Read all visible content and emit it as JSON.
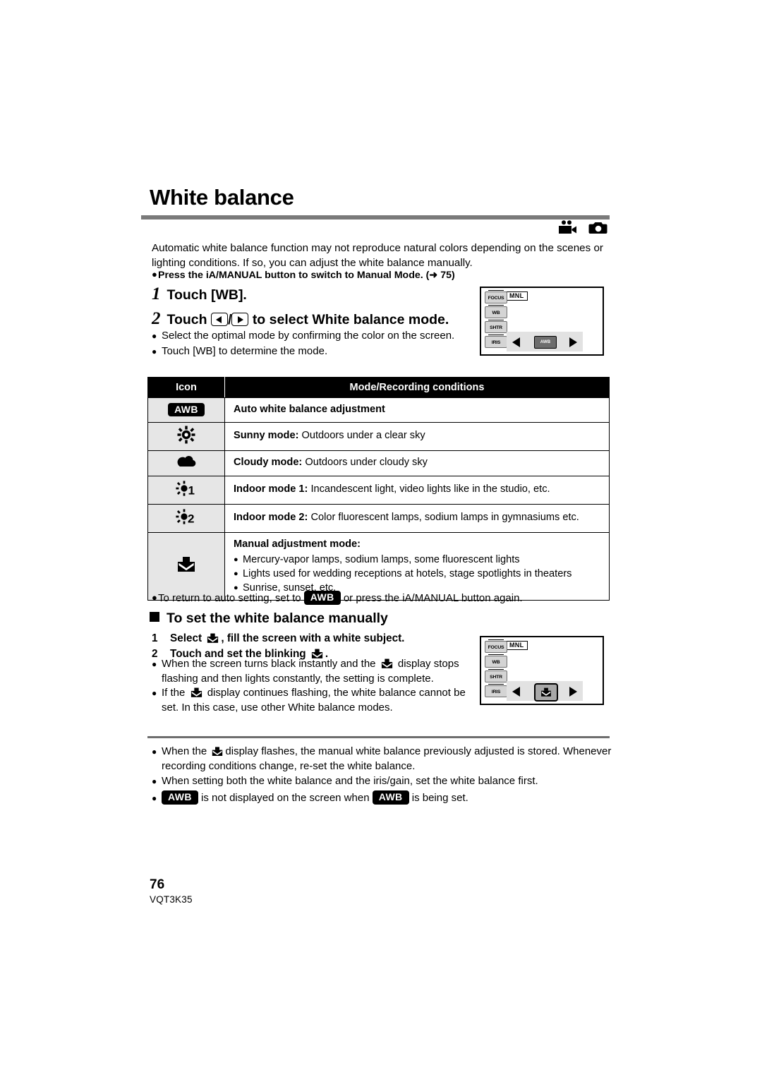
{
  "page": {
    "title": "White balance",
    "number": "76",
    "code": "VQT3K35"
  },
  "mode_icons": [
    "video-camera-icon",
    "photo-camera-icon"
  ],
  "intro": {
    "paragraph": "Automatic white balance function may not reproduce natural colors depending on the scenes or lighting conditions. If so, you can adjust the white balance manually.",
    "bullet": "Press the iA/MANUAL button to switch to Manual Mode. (➜ 75)"
  },
  "steps": {
    "step1_num": "1",
    "step1_text": "Touch [WB].",
    "step2_num": "2",
    "step2_prefix": "Touch",
    "step2_suffix": "to select White balance mode.",
    "notes": [
      "Select the optimal mode by confirming the color on the screen.",
      "Touch [WB] to determine the mode."
    ]
  },
  "lcd": {
    "mnl_label": "MNL",
    "side_buttons": [
      "FOCUS",
      "WB",
      "SHTR",
      "IRIS"
    ],
    "awb_chip": "AWB"
  },
  "table": {
    "headers": [
      "Icon",
      "Mode/Recording conditions"
    ],
    "rows": [
      {
        "icon": "awb-chip-icon",
        "icon_text": "AWB",
        "title": "Auto white balance adjustment",
        "detail": ""
      },
      {
        "icon": "sunny-icon",
        "icon_text": "",
        "title": "Sunny mode:",
        "detail": " Outdoors under a clear sky"
      },
      {
        "icon": "cloudy-icon",
        "icon_text": "",
        "title": "Cloudy mode:",
        "detail": " Outdoors under cloudy sky"
      },
      {
        "icon": "indoor-1-icon",
        "icon_text": "",
        "title": "Indoor mode 1:",
        "detail": " Incandescent light, video lights like in the studio, etc."
      },
      {
        "icon": "indoor-2-icon",
        "icon_text": "",
        "title": "Indoor mode 2:",
        "detail": " Color fluorescent lamps, sodium lamps in gymnasiums etc."
      },
      {
        "icon": "manual-wb-icon",
        "icon_text": "",
        "title": "Manual adjustment mode:",
        "detail": "",
        "sublist": [
          "Mercury-vapor lamps, sodium lamps, some fluorescent lights",
          "Lights used for wedding receptions at hotels, stage spotlights in theaters",
          "Sunrise, sunset, etc."
        ]
      }
    ]
  },
  "return_note": {
    "prefix": "To return to auto setting, set to",
    "chip": "AWB",
    "suffix": "or press the iA/MANUAL button again."
  },
  "manual_section": {
    "heading": "To set the white balance manually",
    "step1_num": "1",
    "step1_prefix": "Select",
    "step1_suffix": ", fill the screen with a white subject.",
    "step2_num": "2",
    "step2_prefix": "Touch and set the blinking",
    "step2_suffix": ".",
    "note1_a": "When the screen turns black instantly and the",
    "note1_b": "display stops flashing and then lights constantly, the setting is complete.",
    "note2_a": "If the",
    "note2_b": "display continues flashing, the white balance cannot be set. In this case, use other White balance modes."
  },
  "end_notes": {
    "note1_a": "When the",
    "note1_b": "display flashes, the manual white balance previously adjusted is stored. Whenever recording conditions change, re-set the white balance.",
    "note2": "When setting both the white balance and the iris/gain, set the white balance first.",
    "note3_a": "AWB",
    "note3_b": "is not displayed on the screen when",
    "note3_c": "AWB",
    "note3_d": "is being set."
  },
  "colors": {
    "rule": "#7a7a7a",
    "icon_cell_bg": "#e6e6e6",
    "header_bg": "#000000"
  }
}
